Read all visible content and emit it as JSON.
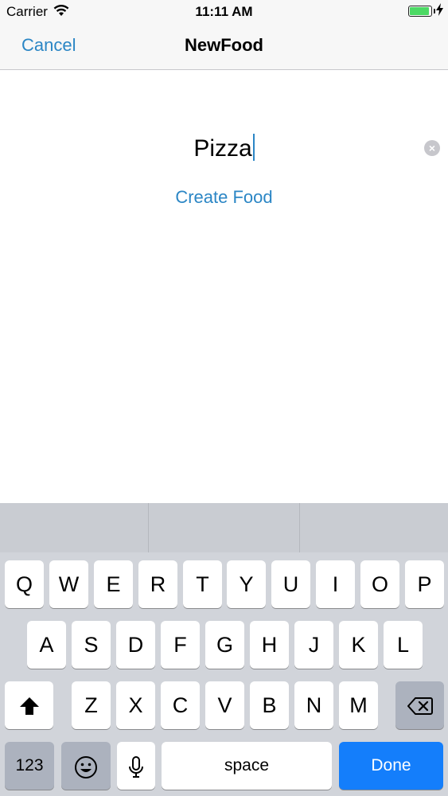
{
  "status_bar": {
    "carrier": "Carrier",
    "time": "11:11 AM",
    "battery_level": 0.85
  },
  "nav": {
    "cancel_label": "Cancel",
    "title": "NewFood"
  },
  "form": {
    "food_name_value": "Pizza",
    "create_label": "Create Food"
  },
  "keyboard": {
    "row1": [
      "Q",
      "W",
      "E",
      "R",
      "T",
      "Y",
      "U",
      "I",
      "O",
      "P"
    ],
    "row2": [
      "A",
      "S",
      "D",
      "F",
      "G",
      "H",
      "J",
      "K",
      "L"
    ],
    "row3": [
      "Z",
      "X",
      "C",
      "V",
      "B",
      "N",
      "M"
    ],
    "numbers_label": "123",
    "space_label": "space",
    "done_label": "Done"
  },
  "colors": {
    "accent": "#2b86c5",
    "done_key": "#147efb",
    "battery": "#4cd964"
  },
  "icons": [
    "wifi-icon",
    "battery-icon",
    "charging-bolt-icon",
    "clear-text-icon",
    "shift-icon",
    "delete-icon",
    "emoji-icon",
    "microphone-icon"
  ]
}
